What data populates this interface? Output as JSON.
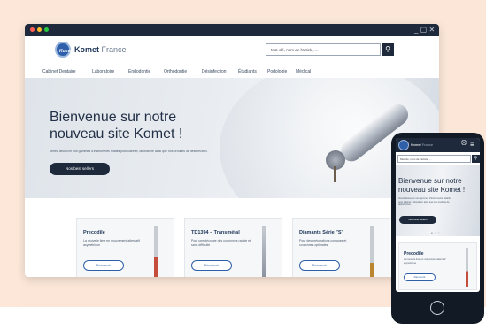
{
  "window": {
    "controls": "_ ▢ ✕"
  },
  "brand": {
    "name": "Komet",
    "region": "France",
    "logo_text": "Komet"
  },
  "search": {
    "placeholder": "Mot-clé, nom de l'article, ...",
    "button_icon": "search-icon"
  },
  "nav": {
    "items": [
      "Cabinet Dentaire",
      "Laboratoire",
      "Endodontie",
      "Orthodontie",
      "Désinfection",
      "Étudiants",
      "Podologie",
      "Médical"
    ]
  },
  "hero": {
    "title_line1": "Bienvenue sur notre",
    "title_line2": "nouveau site Komet !",
    "subtitle": "Venez découvrir nos gammes d'instruments rotatifs pour cabinet, laboratoire ainsi que nos produits de désinfection.",
    "button": "Nos best sellers"
  },
  "cards": [
    {
      "title": "Precodile",
      "text": "La nouvelle lime en mouvement alternatif asymétrique",
      "button": "Découvrir"
    },
    {
      "title": "TD1394 – Transmétal",
      "text": "Pour une découpe des couronnes rapide et sans difficulté",
      "button": "Découvrir"
    },
    {
      "title": "Diamants Série \"S\"",
      "text": "Pour des préparations coniques et couronnes optimales",
      "button": "Découvrir"
    }
  ],
  "phone": {
    "brand": "Komet",
    "region": "France",
    "search_placeholder": "Mot-clé, nom de l'article, ...",
    "hero_title": "Bienvenue sur notre nouveau site Komet !",
    "hero_subtitle": "Venez découvrir nos gammes d'instruments rotatifs pour cabinet, laboratoire ainsi que nos produits de désinfection.",
    "hero_button": "Nos best sellers",
    "card_title": "Precodile",
    "card_text": "La nouvelle lime en mouvement alternatif asymétrique",
    "card_button": "Découvrir"
  },
  "colors": {
    "navy": "#1e2a3b",
    "accent": "#2f5fa8",
    "background": "#fbe6d8"
  }
}
